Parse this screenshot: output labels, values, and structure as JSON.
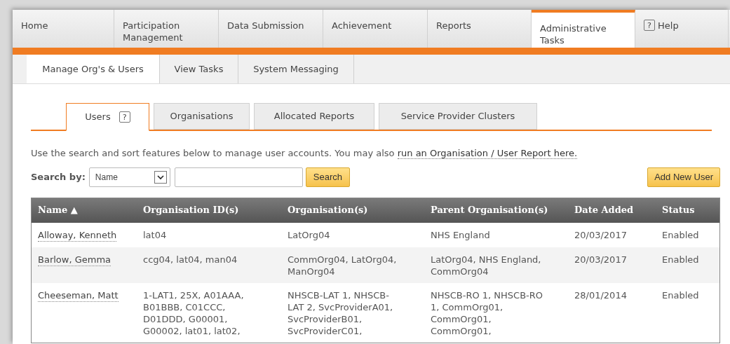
{
  "nav": [
    {
      "label": "Home",
      "selected": false,
      "kind": "text"
    },
    {
      "label": "Participation Management",
      "selected": false,
      "kind": "text"
    },
    {
      "label": "Data Submission",
      "selected": false,
      "kind": "text"
    },
    {
      "label": "Achievement",
      "selected": false,
      "kind": "text"
    },
    {
      "label": "Reports",
      "selected": false,
      "kind": "text"
    },
    {
      "label": "Administrative Tasks",
      "selected": true,
      "kind": "text"
    },
    {
      "label": "Help",
      "selected": false,
      "kind": "help",
      "icon": "?"
    }
  ],
  "subtabs": [
    {
      "label": "Manage Org's & Users",
      "selected": true
    },
    {
      "label": "View Tasks",
      "selected": false
    },
    {
      "label": "System Messaging",
      "selected": false
    }
  ],
  "tabs": [
    {
      "label": "Users",
      "selected": true,
      "icon": "?"
    },
    {
      "label": "Organisations",
      "selected": false
    },
    {
      "label": "Allocated Reports",
      "selected": false
    },
    {
      "label": "Service Provider Clusters",
      "selected": false
    }
  ],
  "intro": {
    "text": "Use the search and sort features below to manage user accounts. You may also",
    "link": "run an Organisation / User Report here."
  },
  "search": {
    "label": "Search by:",
    "select": "Name",
    "button": "Search"
  },
  "add_button": "Add New User",
  "table": {
    "columns": [
      "Name ▲",
      "Organisation ID(s)",
      "Organisation(s)",
      "Parent Organisation(s)",
      "Date Added",
      "Status"
    ],
    "rows": [
      {
        "cells": [
          [
            "Alloway, Kenneth"
          ],
          [
            "lat04"
          ],
          [
            "LatOrg04"
          ],
          [
            "NHS England"
          ],
          [
            "20/03/2017"
          ],
          [
            "Enabled"
          ]
        ]
      },
      {
        "cells": [
          [
            "Barlow, Gemma"
          ],
          [
            "ccg04, lat04, man04"
          ],
          [
            "CommOrg04, LatOrg04,",
            "ManOrg04"
          ],
          [
            "LatOrg04, NHS England,",
            "CommOrg04"
          ],
          [
            "20/03/2017"
          ],
          [
            "Enabled"
          ]
        ]
      },
      {
        "cells": [
          [
            "Cheeseman, Matt"
          ],
          [
            "1-LAT1, 25X, A01AAA,",
            "B01BBB, C01CCC,",
            "D01DDD, G00001,",
            "G00002, lat01, lat02,"
          ],
          [
            "NHSCB-LAT 1, NHSCB-",
            "LAT 2, SvcProviderA01,",
            "SvcProviderB01,",
            "SvcProviderC01,"
          ],
          [
            "NHSCB-RO 1, NHSCB-RO",
            "1, CommOrg01,",
            "CommOrg01,",
            "CommOrg01,"
          ],
          [
            "28/01/2014"
          ],
          [
            "Enabled"
          ]
        ]
      }
    ]
  }
}
